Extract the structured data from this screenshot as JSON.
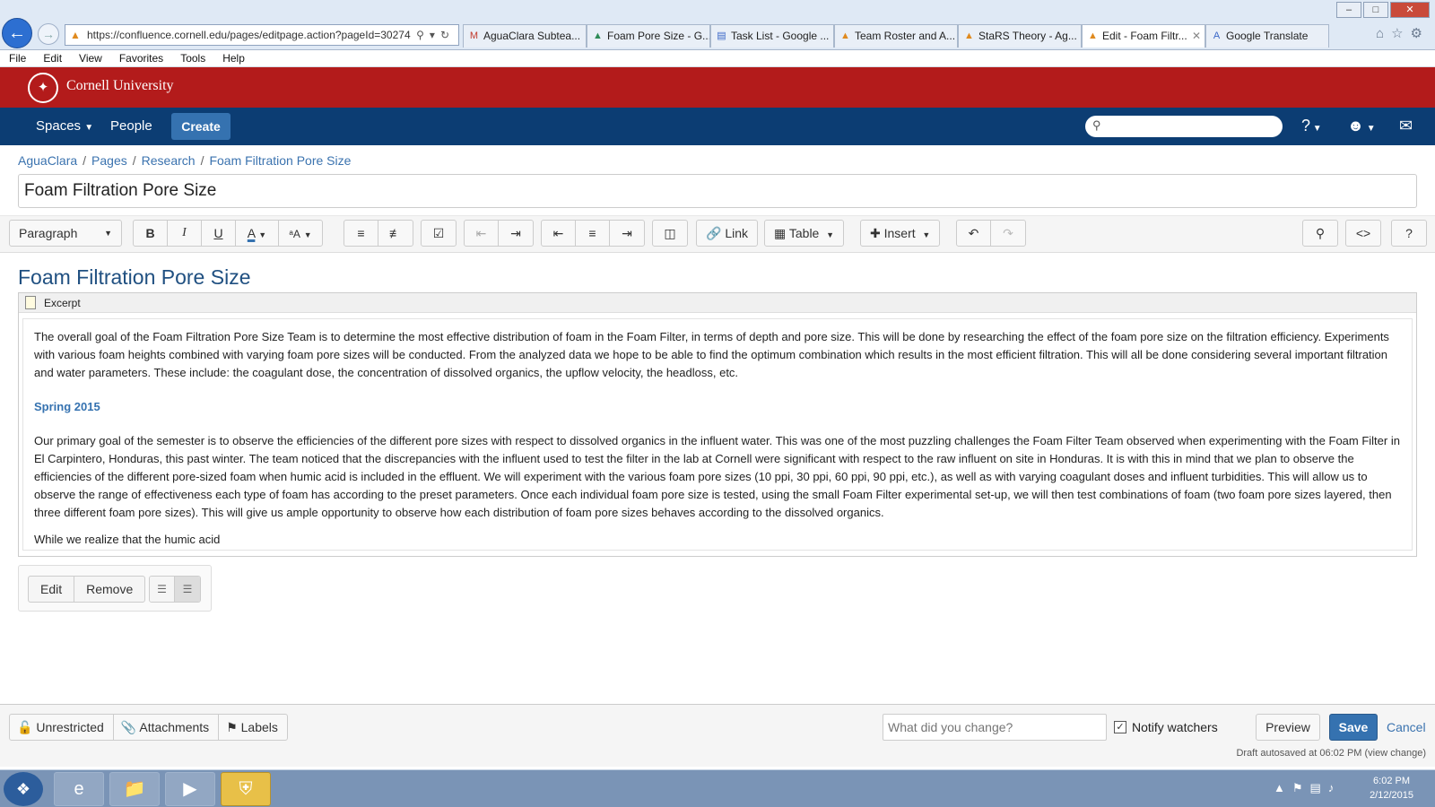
{
  "browser": {
    "url": "https://confluence.cornell.edu/pages/editpage.action?pageId=30274",
    "tabs": [
      {
        "label": "AguaClara Subtea...",
        "icon": "M",
        "color": "#c2392b"
      },
      {
        "label": "Foam Pore Size - G...",
        "icon": "▲",
        "color": "#2e8b57"
      },
      {
        "label": "Task List - Google ...",
        "icon": "▤",
        "color": "#3a67c8"
      },
      {
        "label": "Team Roster and A...",
        "icon": "▲",
        "color": "#e08a1e"
      },
      {
        "label": "StaRS Theory - Ag...",
        "icon": "▲",
        "color": "#e08a1e"
      },
      {
        "label": "Edit - Foam Filtr...",
        "icon": "▲",
        "color": "#e08a1e"
      },
      {
        "label": "Google Translate",
        "icon": "A",
        "color": "#3a67c8"
      }
    ],
    "menu": [
      "File",
      "Edit",
      "View",
      "Favorites",
      "Tools",
      "Help"
    ]
  },
  "header": {
    "university": "Cornell University"
  },
  "nav": {
    "spaces": "Spaces",
    "people": "People",
    "create": "Create"
  },
  "breadcrumb": [
    "AguaClara",
    "Pages",
    "Research",
    "Foam Filtration Pore Size"
  ],
  "page_title": "Foam Filtration Pore Size",
  "toolbar": {
    "paragraph": "Paragraph",
    "link": "Link",
    "table": "Table",
    "insert": "Insert"
  },
  "content": {
    "heading": "Foam Filtration Pore Size",
    "excerpt_label": "Excerpt",
    "p1": "The overall goal of the Foam Filtration Pore Size Team is to determine the most effective distribution of foam in the Foam Filter, in terms of depth and pore size. This will be done by researching the effect of the foam pore size on the filtration efficiency. Experiments with various foam heights combined with varying foam pore sizes will be conducted. From the analyzed data we hope to be able to find the optimum combination which results in the most efficient filtration. This will all be done considering several important filtration and water parameters. These include: the coagulant dose, the concentration of dissolved organics, the upflow velocity, the headloss, etc.",
    "section_heading": "Spring 2015",
    "p2": "Our primary goal of the semester is to observe the efficiencies of the different pore sizes with respect to dissolved organics in the influent water. This was one of the most puzzling challenges the Foam Filter Team observed when experimenting with the Foam Filter in El Carpintero, Honduras, this past winter. The team noticed that the discrepancies with the influent used to test the filter in the lab at Cornell were significant with respect to the raw influent on site in Honduras. It is with this in mind that we plan to observe the efficiencies of the different pore-sized foam when humic acid is included in the effluent. We will experiment with the various foam pore sizes (10 ppi, 30 ppi, 60 ppi, 90 ppi, etc.), as well as with varying coagulant doses and influent turbidities. This will allow us to observe the range of effectiveness each type of foam has according to the preset parameters. Once each individual foam pore size is tested, using the small Foam Filter experimental set-up, we will then test combinations of foam (two foam pore sizes layered, then three different foam pore sizes). This will give us ample opportunity to observe how each distribution of foam pore sizes behaves according to the dissolved organics.",
    "p3": "While we realize that the humic acid"
  },
  "macro": {
    "edit": "Edit",
    "remove": "Remove"
  },
  "footer": {
    "unrestricted": "Unrestricted",
    "attachments": "Attachments",
    "labels": "Labels",
    "change_placeholder": "What did you change?",
    "notify": "Notify watchers",
    "preview": "Preview",
    "save": "Save",
    "cancel": "Cancel",
    "autosave": "Draft autosaved at 06:02 PM (view change)"
  },
  "taskbar": {
    "time": "6:02 PM",
    "date": "2/12/2015"
  }
}
